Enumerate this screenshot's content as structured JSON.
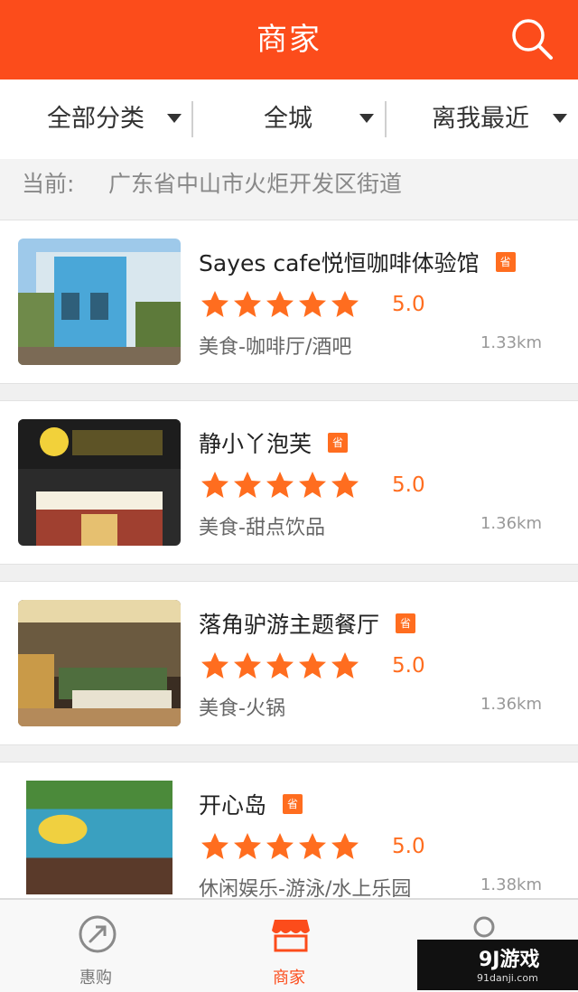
{
  "header": {
    "title": "商家"
  },
  "filters": [
    {
      "label": "全部分类"
    },
    {
      "label": "全城"
    },
    {
      "label": "离我最近"
    }
  ],
  "location": {
    "label": "当前:",
    "value": "广东省中山市火炬开发区街道"
  },
  "merchants": [
    {
      "name": "Sayes cafe悦恒咖啡体验馆",
      "badge": "省",
      "rating": "5.0",
      "stars": 5,
      "category": "美食-咖啡厅/酒吧",
      "distance": "1.33km"
    },
    {
      "name": "静小丫泡芙",
      "badge": "省",
      "rating": "5.0",
      "stars": 5,
      "category": "美食-甜点饮品",
      "distance": "1.36km"
    },
    {
      "name": "落角驴游主题餐厅",
      "badge": "省",
      "rating": "5.0",
      "stars": 5,
      "category": "美食-火锅",
      "distance": "1.36km"
    },
    {
      "name": "开心岛",
      "badge": "省",
      "rating": "5.0",
      "stars": 5,
      "category": "休闲娱乐-游泳/水上乐园",
      "distance": "1.38km"
    }
  ],
  "tabbar": {
    "tabs": [
      {
        "label": "惠购",
        "icon": "compass-icon",
        "active": false
      },
      {
        "label": "商家",
        "icon": "store-icon",
        "active": true
      },
      {
        "label": "",
        "icon": "user-icon",
        "active": false
      }
    ]
  },
  "watermark": {
    "brand": "9J游戏",
    "site": "91danji.com"
  },
  "colors": {
    "accent": "#fc4c1b",
    "star": "#ff6d1f",
    "background": "#f0f0f0"
  }
}
